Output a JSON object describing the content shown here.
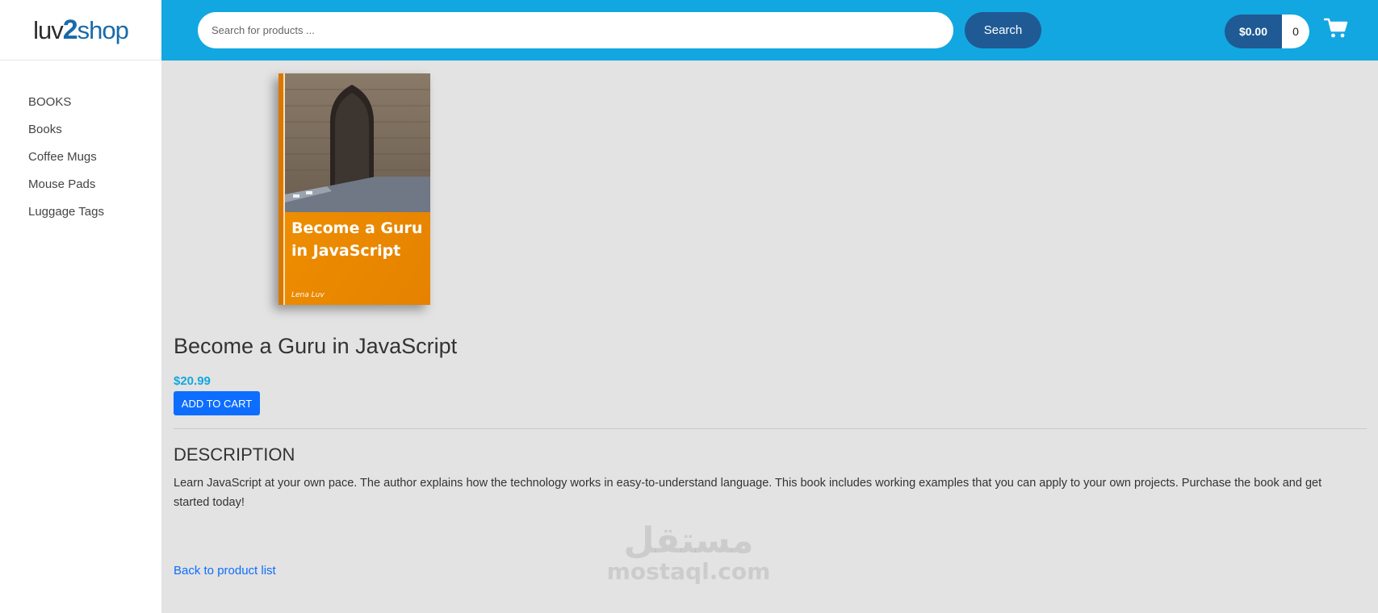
{
  "logo": {
    "part1": "luv",
    "part2": "2",
    "part3": "shop"
  },
  "sidebar": {
    "items": [
      {
        "label": "BOOKS"
      },
      {
        "label": "Books"
      },
      {
        "label": "Coffee Mugs"
      },
      {
        "label": "Mouse Pads"
      },
      {
        "label": "Luggage Tags"
      }
    ]
  },
  "header": {
    "search_placeholder": "Search for products ...",
    "search_label": "Search",
    "cart_total": "$0.00",
    "cart_quantity": "0",
    "cart_icon": "shopping-cart-icon"
  },
  "product": {
    "cover_title_line1": "Become a Guru",
    "cover_title_line2": "in JavaScript",
    "cover_author": "Lena Luv",
    "name": "Become a Guru in JavaScript",
    "price": "$20.99",
    "add_to_cart_label": "ADD TO CART",
    "description_heading": "DESCRIPTION",
    "description": "Learn JavaScript at your own pace. The author explains how the technology works in easy-to-understand language. This book includes working examples that you can apply to your own projects. Purchase the book and get started today!",
    "back_link": "Back to product list"
  },
  "watermark": {
    "arabic": "مستقل",
    "latin": "mostaql.com"
  },
  "colors": {
    "header": "#12a7e0",
    "accent_dark": "#1f5a94",
    "button_primary": "#0d6efd",
    "price": "#12a7e0",
    "page_bg": "#e3e3e3",
    "cover_orange": "#f08c00"
  }
}
